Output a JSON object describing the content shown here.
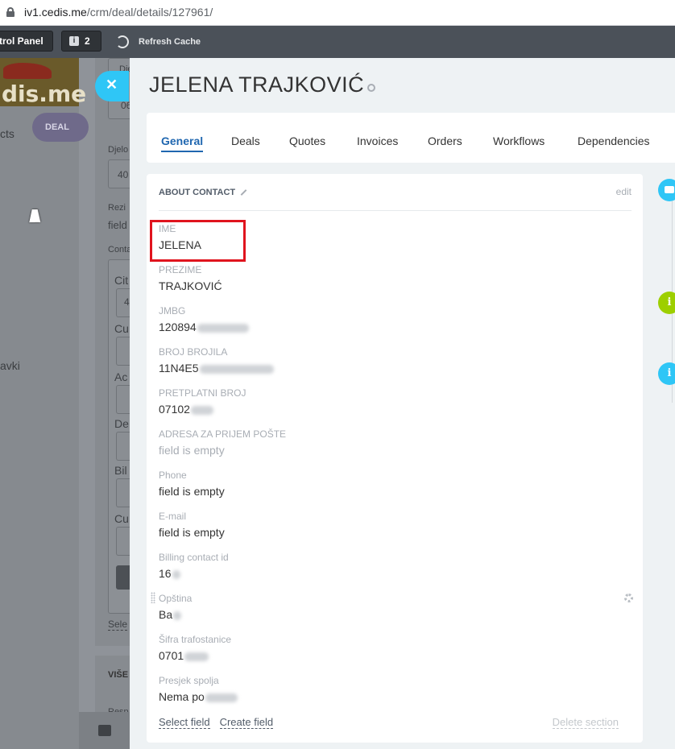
{
  "browser": {
    "url_host": "iv1.cedis.me",
    "url_path": "/crm/deal/details/127961/"
  },
  "toolbar": {
    "control_panel": "trol Panel",
    "notifications_count": "2",
    "refresh_cache": "Refresh Cache"
  },
  "background": {
    "logo_text": "dis.me",
    "contacts_fragment": "cts",
    "deal_pill": "DEAL",
    "sidebar_fragment": "avki",
    "col_labels": [
      "Djelo",
      "Rezi",
      "field",
      "Conta",
      "Cit",
      "Cu",
      "Ac",
      "De",
      "Bil",
      "Cu"
    ],
    "col_values": [
      "06",
      "40",
      "4"
    ],
    "select_fragment": "Sele",
    "more_title": "VIŠE",
    "more_row": "Resp"
  },
  "slider": {
    "close_icon": "close-icon",
    "title": "JELENA  TRAJKOVIĆ",
    "tabs": [
      {
        "label": "General",
        "active": true
      },
      {
        "label": "Deals"
      },
      {
        "label": "Quotes"
      },
      {
        "label": "Invoices"
      },
      {
        "label": "Orders"
      },
      {
        "label": "Workflows"
      },
      {
        "label": "Dependencies"
      }
    ]
  },
  "card": {
    "title": "ABOUT CONTACT",
    "edit": "edit",
    "fields": [
      {
        "label": "IME",
        "value": "JELENA"
      },
      {
        "label": "PREZIME",
        "value": "TRAJKOVIĆ"
      },
      {
        "label": "JMBG",
        "value": "120894"
      },
      {
        "label": "BROJ BROJILA",
        "value": "11N4E5"
      },
      {
        "label": "PRETPLATNI BROJ",
        "value": "07102"
      },
      {
        "label": "ADRESA ZA PRIJEM POŠTE",
        "value": "field is empty"
      },
      {
        "label": "Phone",
        "value": "field is empty"
      },
      {
        "label": "E-mail",
        "value": "field is empty"
      },
      {
        "label": "Billing contact id",
        "value": "16"
      },
      {
        "label": "Opština",
        "value": "Ba"
      },
      {
        "label": "Šifra trafostanice",
        "value": "0701"
      },
      {
        "label": "Presjek spolja",
        "value": "Nema po"
      }
    ],
    "select_field": "Select field",
    "create_field": "Create field",
    "delete_section": "Delete section"
  },
  "timeline": {
    "icons": [
      "chat-icon",
      "info-icon",
      "info-icon"
    ],
    "info_glyph": "i",
    "colors": {
      "chat": "#2fc6f6",
      "info_green": "#9dcf00",
      "info_blue": "#2fc6f6"
    }
  },
  "colors": {
    "accent": "#2067b0",
    "highlight": "#e0141e"
  }
}
